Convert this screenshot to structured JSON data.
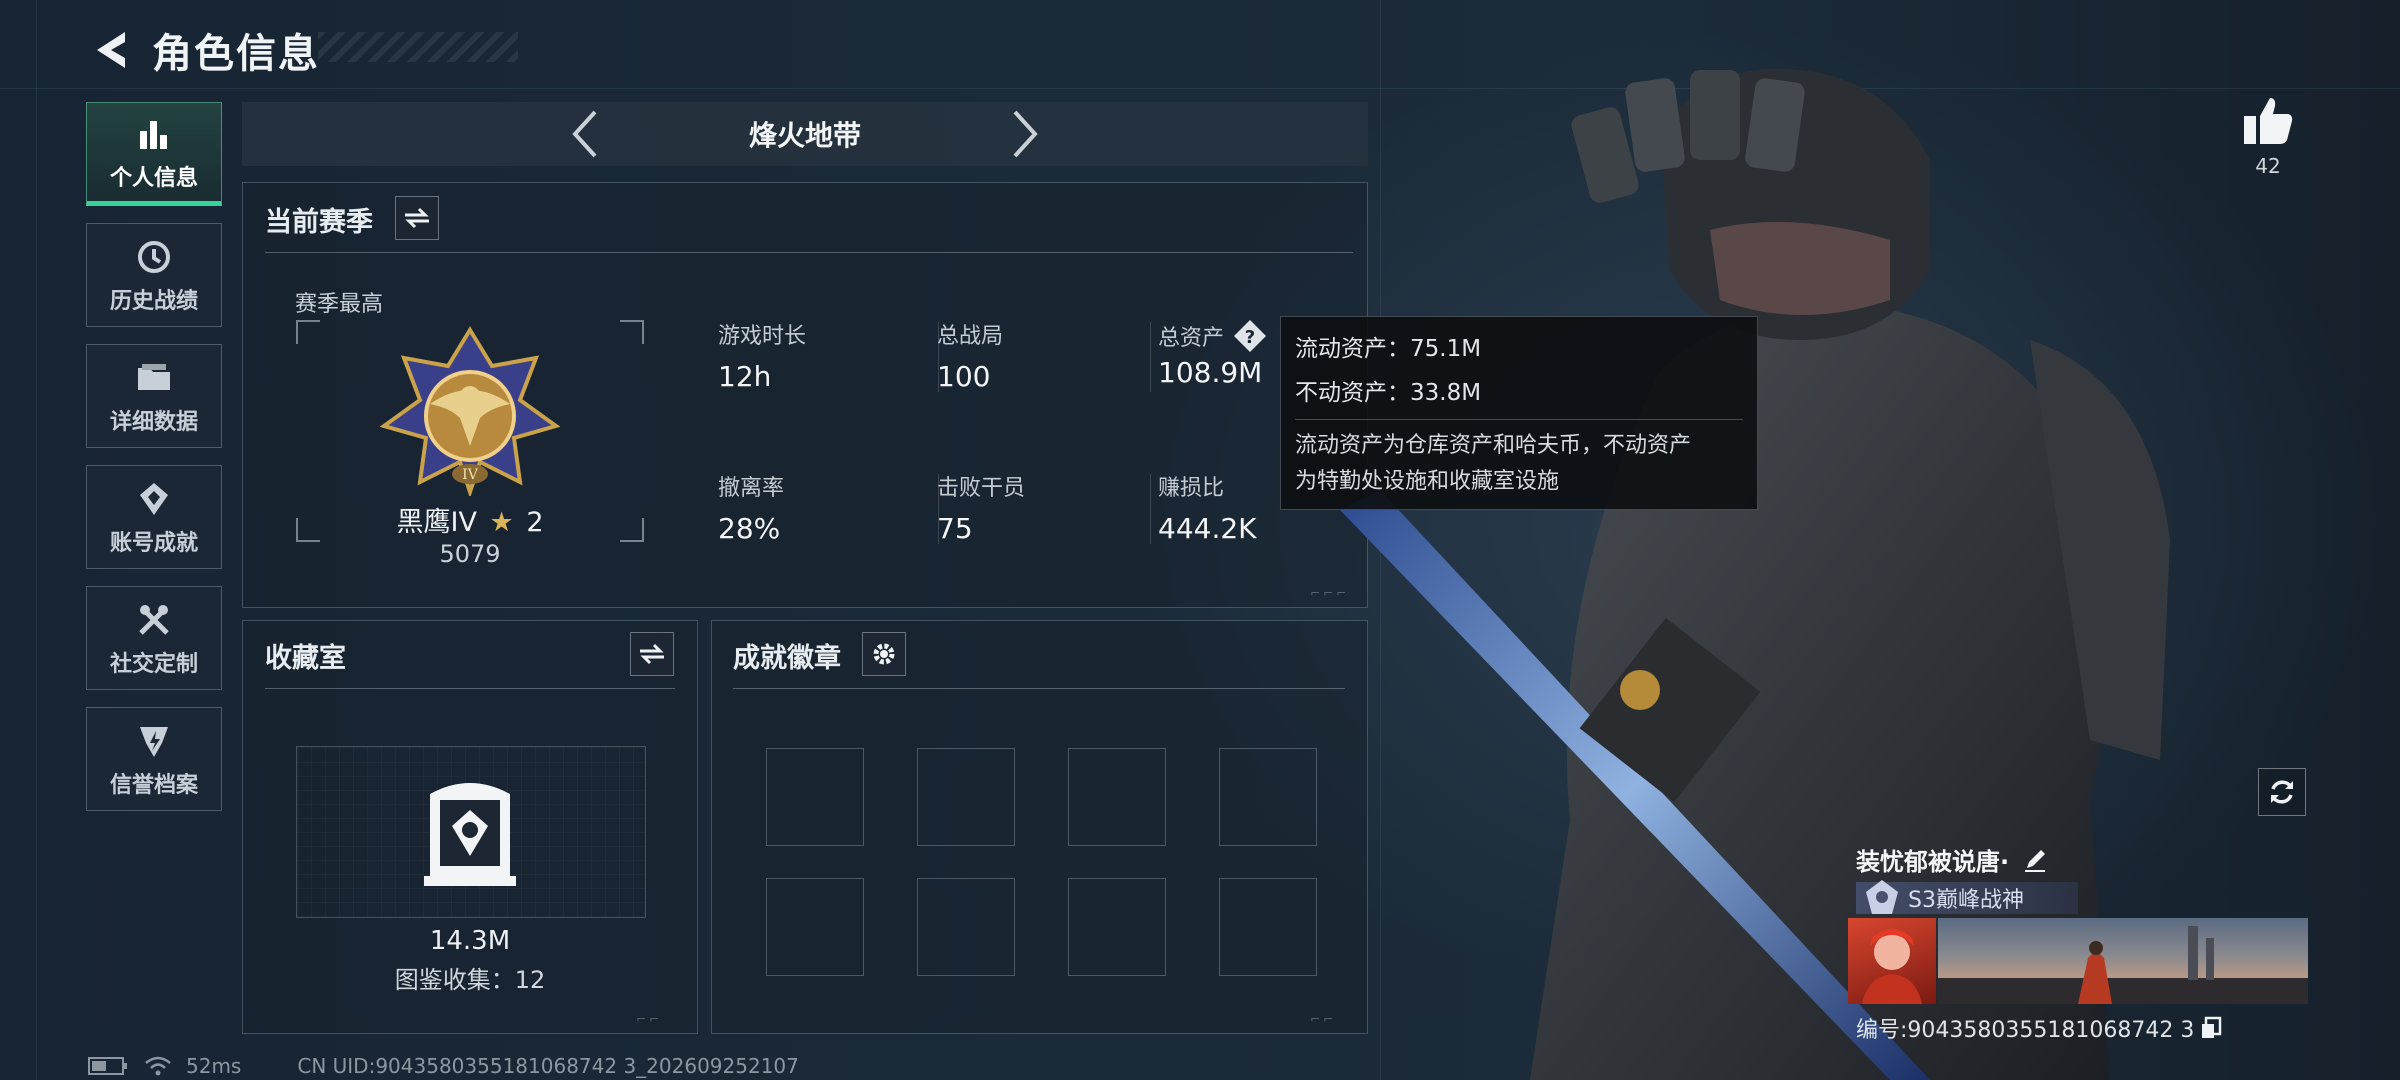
{
  "header": {
    "title": "角色信息"
  },
  "nav": {
    "items": [
      {
        "label": "个人信息",
        "icon": "bar-chart-icon",
        "active": true
      },
      {
        "label": "历史战绩",
        "icon": "history-icon",
        "active": false
      },
      {
        "label": "详细数据",
        "icon": "folder-icon",
        "active": false
      },
      {
        "label": "账号成就",
        "icon": "achievement-icon",
        "active": false
      },
      {
        "label": "社交定制",
        "icon": "tools-icon",
        "active": false
      },
      {
        "label": "信誉档案",
        "icon": "credit-icon",
        "active": false
      }
    ]
  },
  "season_switcher": {
    "current": "烽火地带"
  },
  "current_season": {
    "title": "当前赛季",
    "best_label": "赛季最高",
    "rank_name": "黑鹰IV",
    "rank_stars": "2",
    "rank_score": "5079",
    "stats": [
      {
        "label": "游戏时长",
        "value": "12h"
      },
      {
        "label": "总战局",
        "value": "100"
      },
      {
        "label": "总资产",
        "value": "108.9M"
      },
      {
        "label": "撤离率",
        "value": "28%"
      },
      {
        "label": "击败干员",
        "value": "75"
      },
      {
        "label": "赚损比",
        "value": "444.2K"
      }
    ]
  },
  "tooltip": {
    "liquid": "流动资产：75.1M",
    "fixed": "不动资产：33.8M",
    "desc_line1": "流动资产为仓库资产和哈夫币，不动资产",
    "desc_line2": "为特勤处设施和收藏室设施"
  },
  "collection": {
    "title": "收藏室",
    "value": "14.3M",
    "count_text": "图鉴收集：12"
  },
  "badges": {
    "title": "成就徽章",
    "slots": 8
  },
  "like": {
    "count": "42"
  },
  "player": {
    "name": "装忧郁被说唐·",
    "title_badge": "S3巅峰战神",
    "uid_text": "编号:9043580355181068742 3"
  },
  "status": {
    "ping": "52ms",
    "cn_uid": "CN UID:9043580355181068742 3_202609252107"
  },
  "colors": {
    "accent": "#35d39a",
    "panel_border": "#aabecd"
  }
}
